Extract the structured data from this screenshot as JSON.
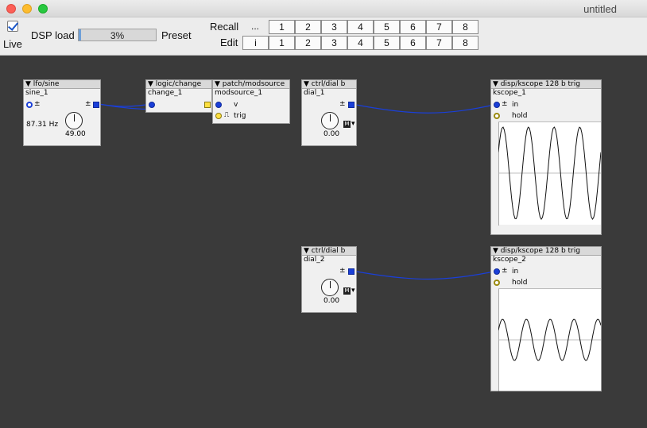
{
  "window": {
    "title": "untitled"
  },
  "toolbar": {
    "live_label": "Live",
    "live_checked": true,
    "dsp_label": "DSP load",
    "dsp_value": "3%",
    "dsp_fraction": 0.03,
    "preset_label": "Preset",
    "recall_label": "Recall",
    "edit_label": "Edit",
    "recall_more": "...",
    "edit_init": "i",
    "slots": [
      "1",
      "2",
      "3",
      "4",
      "5",
      "6",
      "7",
      "8"
    ]
  },
  "objects": {
    "lfo": {
      "type": "lfo/sine",
      "name": "sine_1",
      "freq": "87.31 Hz",
      "value": "49.00",
      "pm": "±",
      "pm_out": "±"
    },
    "change": {
      "type": "logic/change",
      "name": "change_1"
    },
    "modsource": {
      "type": "patch/modsource",
      "name": "modsource_1",
      "in_v": "v",
      "in_trig": "trig"
    },
    "dial1": {
      "type": "ctrl/dial b",
      "name": "dial_1",
      "value": "0.00",
      "pm": "±",
      "m": "M"
    },
    "dial2": {
      "type": "ctrl/dial b",
      "name": "dial_2",
      "value": "0.00",
      "pm": "±",
      "m": "M"
    },
    "kscope1": {
      "type": "disp/kscope 128 b trig",
      "name": "kscope_1",
      "in": "in",
      "pm": "±",
      "hold": "hold"
    },
    "kscope2": {
      "type": "disp/kscope 128 b trig",
      "name": "kscope_2",
      "in": "in",
      "pm": "±",
      "hold": "hold"
    }
  }
}
